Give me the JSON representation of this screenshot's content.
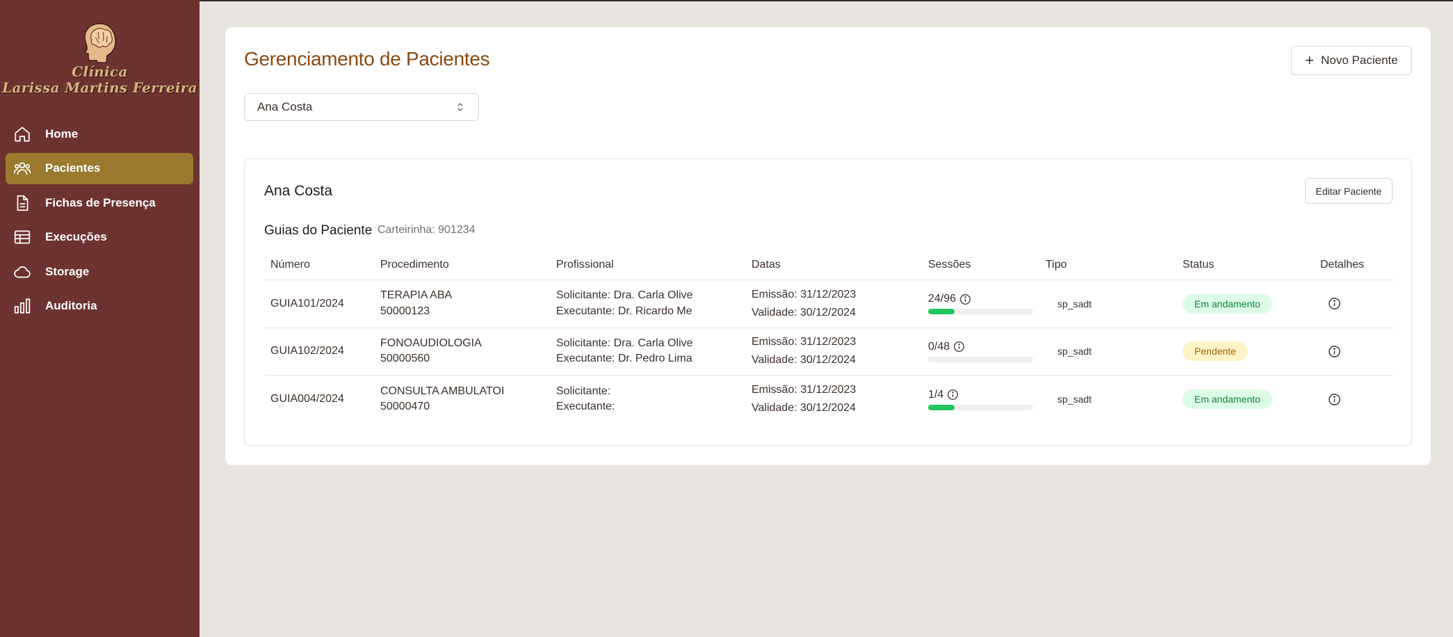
{
  "brand": {
    "line1": "Clínica",
    "line2": "Larissa Martins Ferreira"
  },
  "sidebar": {
    "items": [
      {
        "label": "Home",
        "icon": "home-icon",
        "active": false
      },
      {
        "label": "Pacientes",
        "icon": "users-icon",
        "active": true
      },
      {
        "label": "Fichas de Presença",
        "icon": "file-icon",
        "active": false
      },
      {
        "label": "Execuções",
        "icon": "table-icon",
        "active": false
      },
      {
        "label": "Storage",
        "icon": "cloud-icon",
        "active": false
      },
      {
        "label": "Auditoria",
        "icon": "bar-chart-icon",
        "active": false
      }
    ]
  },
  "page": {
    "title": "Gerenciamento de Pacientes",
    "new_button": "Novo Paciente",
    "selected_patient": "Ana Costa"
  },
  "patient": {
    "name": "Ana Costa",
    "edit_button": "Editar Paciente",
    "guides_title": "Guias do Paciente",
    "card_number": "Carteirinha: 901234"
  },
  "table": {
    "headers": [
      "Número",
      "Procedimento",
      "Profissional",
      "Datas",
      "Sessões",
      "Tipo",
      "Status",
      "Detalhes"
    ],
    "rows": [
      {
        "numero": "GUIA101/2024",
        "procedimento": "TERAPIA ABA",
        "codigo": "50000123",
        "solicitante": "Solicitante: Dra. Carla Olive",
        "executante": "Executante: Dr. Ricardo Me",
        "emissao": "Emissão: 31/12/2023",
        "validade": "Validade: 30/12/2024",
        "sessoes": "24/96",
        "progress": 0.25,
        "tipo": "sp_sadt",
        "status": "Em andamento",
        "status_kind": "running"
      },
      {
        "numero": "GUIA102/2024",
        "procedimento": "FONOAUDIOLOGIA",
        "codigo": "50000560",
        "solicitante": "Solicitante: Dra. Carla Olive",
        "executante": "Executante: Dr. Pedro Lima",
        "emissao": "Emissão: 31/12/2023",
        "validade": "Validade: 30/12/2024",
        "sessoes": "0/48",
        "progress": 0,
        "tipo": "sp_sadt",
        "status": "Pendente",
        "status_kind": "pending"
      },
      {
        "numero": "GUIA004/2024",
        "procedimento": "CONSULTA AMBULATOI",
        "codigo": "50000470",
        "solicitante": "Solicitante:",
        "executante": "Executante:",
        "emissao": "Emissão: 31/12/2023",
        "validade": "Validade: 30/12/2024",
        "sessoes": "1/4",
        "progress": 0.25,
        "tipo": "sp_sadt",
        "status": "Em andamento",
        "status_kind": "running"
      }
    ]
  },
  "colors": {
    "sidebar_bg": "#6d3330",
    "active_item": "#9a7a2f",
    "title": "#8a4a10",
    "progress": "#22c55e"
  }
}
